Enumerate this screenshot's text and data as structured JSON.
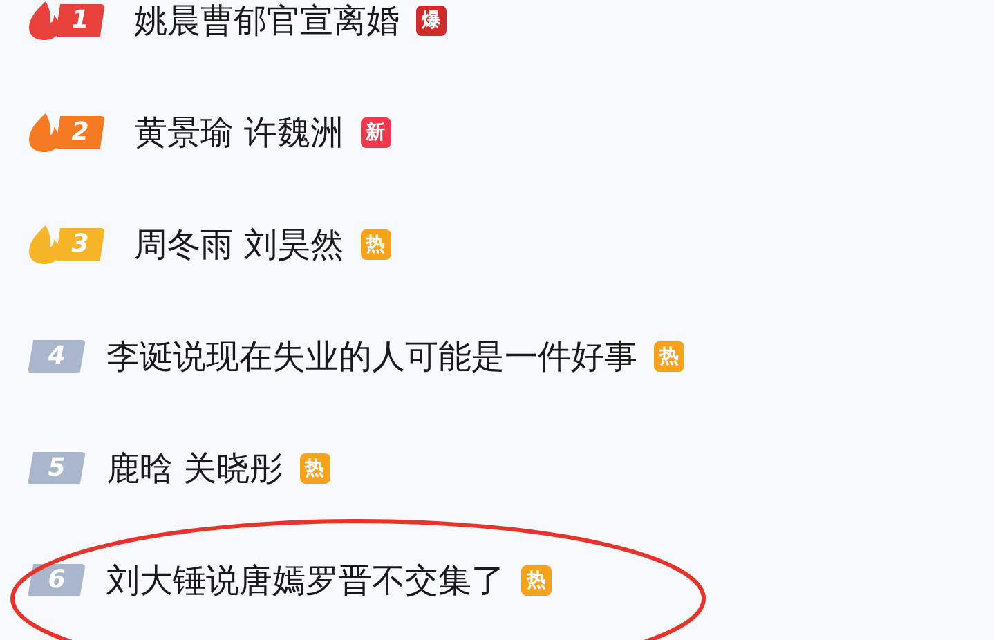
{
  "hot_list": [
    {
      "rank": "1",
      "kind": "flame",
      "color": "#e8403a",
      "title": "姚晨曹郁官宣离婚",
      "tag": {
        "label": "爆",
        "color": "#d42a2a"
      },
      "circled": false
    },
    {
      "rank": "2",
      "kind": "flame",
      "color": "#f57a22",
      "title": "黄景瑜 许魏洲",
      "tag": {
        "label": "新",
        "color": "#ee3a4e"
      },
      "circled": false
    },
    {
      "rank": "3",
      "kind": "flame",
      "color": "#f7b52a",
      "title": "周冬雨 刘昊然",
      "tag": {
        "label": "热",
        "color": "#f7a21b"
      },
      "circled": false
    },
    {
      "rank": "4",
      "kind": "plain",
      "color": "#a9b6cc",
      "title": "李诞说现在失业的人可能是一件好事",
      "tag": {
        "label": "热",
        "color": "#f7a21b"
      },
      "circled": false
    },
    {
      "rank": "5",
      "kind": "plain",
      "color": "#a9b6cc",
      "title": "鹿晗 关晓彤",
      "tag": {
        "label": "热",
        "color": "#f7a21b"
      },
      "circled": false
    },
    {
      "rank": "6",
      "kind": "plain",
      "color": "#a9b6cc",
      "title": "刘大锤说唐嫣罗晋不交集了",
      "tag": {
        "label": "热",
        "color": "#f7a21b"
      },
      "circled": true
    }
  ]
}
